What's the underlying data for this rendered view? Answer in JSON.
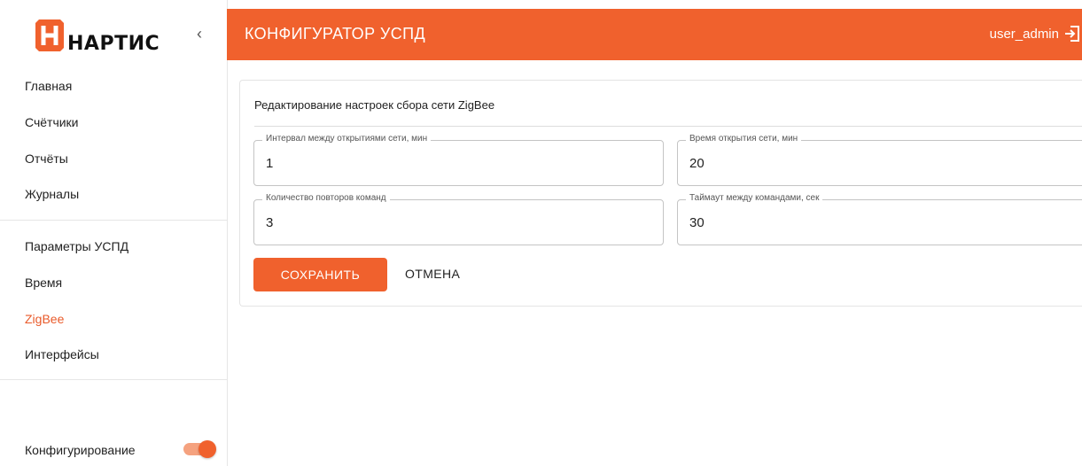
{
  "sidebar": {
    "logo_text": "НАРТИС",
    "items_top": [
      "Главная",
      "Счётчики",
      "Отчёты",
      "Журналы"
    ],
    "items_bottom": [
      "Параметры УСПД",
      "Время",
      "ZigBee",
      "Интерфейсы"
    ],
    "active_item": "ZigBee",
    "config_label": "Конфигурирование",
    "config_toggle_on": true
  },
  "header": {
    "title": "КОНФИГУРАТОР УСПД",
    "user": "user_admin"
  },
  "form": {
    "title": "Редактирование настроек сбора сети ZigBee",
    "fields": [
      {
        "label": "Интервал между открытиями сети, мин",
        "value": "1"
      },
      {
        "label": "Время открытия сети, мин",
        "value": "20"
      },
      {
        "label": "Количество повторов команд",
        "value": "3"
      },
      {
        "label": "Таймаут между командами, сек",
        "value": "30"
      }
    ],
    "save_label": "СОХРАНИТЬ",
    "cancel_label": "ОТМЕНА"
  },
  "colors": {
    "accent": "#f0612d",
    "accent_light": "#f5a27f"
  }
}
